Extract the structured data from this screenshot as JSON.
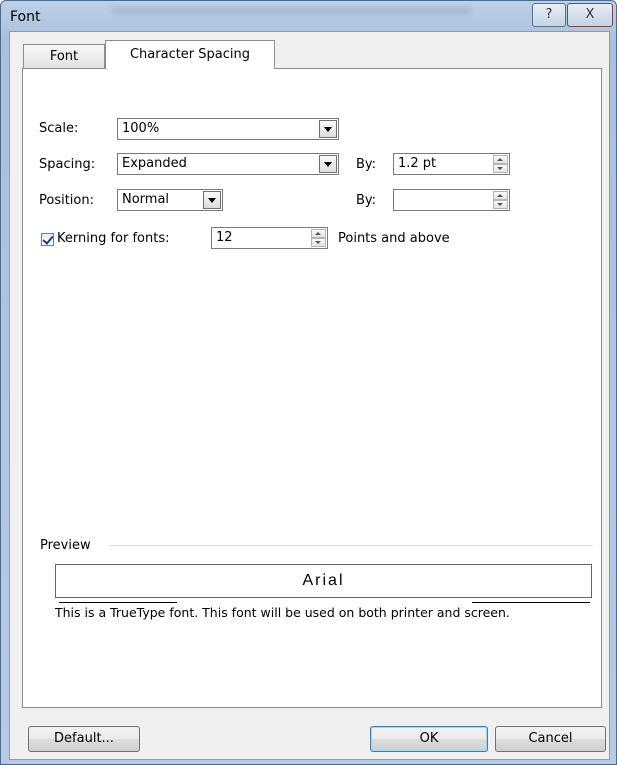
{
  "window": {
    "title": "Font"
  },
  "tabs": [
    {
      "label": "Font",
      "selected": false
    },
    {
      "label": "Character Spacing",
      "selected": true
    }
  ],
  "scale": {
    "label": "Scale:",
    "value": "100%"
  },
  "spacing": {
    "label": "Spacing:",
    "value": "Expanded",
    "by_label": "By:",
    "by_value": "1.2 pt"
  },
  "position": {
    "label": "Position:",
    "value": "Normal",
    "by_label": "By:",
    "by_value": ""
  },
  "kerning": {
    "label": "Kerning for fonts:",
    "checked": true,
    "value": "12",
    "suffix": "Points and above"
  },
  "preview": {
    "label": "Preview",
    "sample_text": "Arial",
    "description": "This is a TrueType font. This font will be used on both printer and screen."
  },
  "buttons": {
    "default": "Default...",
    "ok": "OK",
    "cancel": "Cancel"
  },
  "titlebar_buttons": {
    "help": "?",
    "close": "X"
  }
}
